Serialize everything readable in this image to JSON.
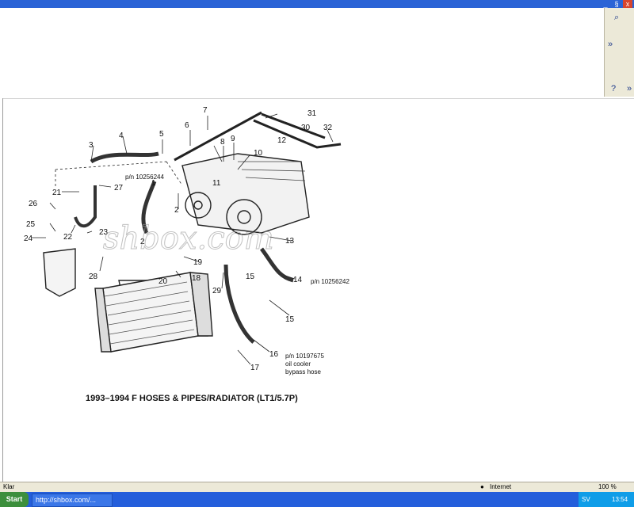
{
  "window": {
    "controls": {
      "minimize": "_",
      "restore": "§",
      "close": "x"
    }
  },
  "toolbar": {
    "chevron": "»",
    "chevron2": "»"
  },
  "diagram": {
    "watermark": "shbox.com",
    "caption": "1993–1994 F HOSES & PIPES/RADIATOR (LT1/5.7P)",
    "part_labels": [
      "1",
      "2",
      "2",
      "3",
      "4",
      "5",
      "6",
      "7",
      "8",
      "9",
      "10",
      "11",
      "12",
      "13",
      "14",
      "15",
      "15",
      "16",
      "17",
      "18",
      "19",
      "20",
      "21",
      "22",
      "23",
      "24",
      "25",
      "26",
      "27",
      "28",
      "29",
      "30",
      "31",
      "32"
    ],
    "notes": {
      "pn1": "p/n 10256244",
      "pn2": "p/n 10256242",
      "pn3": "p/n 10197675",
      "desc1": "oil cooler",
      "desc2": "bypass hose"
    }
  },
  "status": {
    "left": "Klar",
    "zone": "Internet",
    "zoom": "100 %"
  },
  "taskbar": {
    "start": "Start",
    "task": "http://shbox.com/...",
    "lang": "SV",
    "time": "13:54"
  }
}
